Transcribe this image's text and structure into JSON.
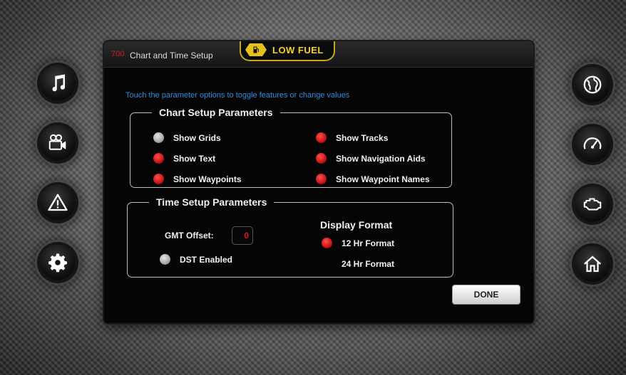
{
  "titlebar": {
    "number": "700",
    "title": "Chart and Time Setup"
  },
  "alert": {
    "label": "LOW FUEL",
    "icon": "fuel-pump-icon",
    "color": "#e6c21a"
  },
  "hint": "Touch the parameter options to toggle features or change values",
  "chart_setup": {
    "title": "Chart Setup Parameters",
    "options": [
      {
        "label": "Show Grids",
        "enabled": false
      },
      {
        "label": "Show Tracks",
        "enabled": true
      },
      {
        "label": "Show Text",
        "enabled": true
      },
      {
        "label": "Show Navigation Aids",
        "enabled": true
      },
      {
        "label": "Show Waypoints",
        "enabled": true
      },
      {
        "label": "Show Waypoint Names",
        "enabled": true
      }
    ]
  },
  "time_setup": {
    "title": "Time Setup Parameters",
    "gmt_label": "GMT Offset:",
    "gmt_value": "0",
    "dst_label": "DST Enabled",
    "dst_enabled": false,
    "display_format_title": "Display Format",
    "formats": [
      {
        "label": "12 Hr Format",
        "selected": true
      },
      {
        "label": "24 Hr Format",
        "selected": false
      }
    ]
  },
  "done_label": "DONE",
  "side_buttons": {
    "left": [
      "music-note-icon",
      "video-camera-icon",
      "warning-icon",
      "settings-gear-icon"
    ],
    "right": [
      "globe-icon",
      "speedometer-icon",
      "engine-icon",
      "home-icon"
    ]
  },
  "colors": {
    "on": "#c81414",
    "off": "#a8a8a8",
    "hint": "#2f8de0",
    "accent": "#f2d22a"
  }
}
